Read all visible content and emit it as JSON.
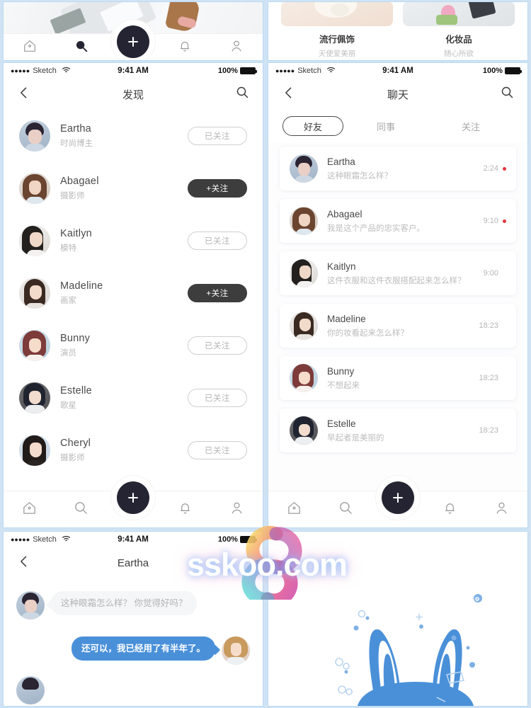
{
  "statusbar": {
    "carrier": "Sketch",
    "dots": "●●●●●",
    "time": "9:41 AM",
    "battery_pct": "100%",
    "wifi_icon": "wifi-icon",
    "battery_icon": "battery-full-icon"
  },
  "top_left": {
    "tabbar": {
      "items": [
        "home-icon",
        "search-icon",
        "bell-icon",
        "person-icon"
      ],
      "fab_icon": "plus-icon"
    }
  },
  "top_right": {
    "categories": [
      {
        "title": "流行佩饰",
        "subtitle": "天使爱美丽"
      },
      {
        "title": "化妆品",
        "subtitle": "随心所欲"
      }
    ]
  },
  "discover": {
    "title": "发现",
    "back_icon": "chevron-left-icon",
    "search_icon": "search-icon",
    "followed_label": "已关注",
    "follow_label": "+关注",
    "users": [
      {
        "name": "Eartha",
        "role": "时尚博主",
        "followed": true
      },
      {
        "name": "Abagael",
        "role": "摄影师",
        "followed": false
      },
      {
        "name": "Kaitlyn",
        "role": "模特",
        "followed": true
      },
      {
        "name": "Madeline",
        "role": "画家",
        "followed": false
      },
      {
        "name": "Bunny",
        "role": "演员",
        "followed": true
      },
      {
        "name": "Estelle",
        "role": "歌星",
        "followed": true
      },
      {
        "name": "Cheryl",
        "role": "摄影师",
        "followed": true
      }
    ],
    "tabbar": {
      "items": [
        "home-icon",
        "search-icon",
        "bell-icon",
        "person-icon"
      ],
      "fab_icon": "plus-icon"
    }
  },
  "chatlist": {
    "title": "聊天",
    "back_icon": "chevron-left-icon",
    "search_icon": "search-icon",
    "tabs": [
      {
        "label": "好友",
        "active": true
      },
      {
        "label": "同事",
        "active": false
      },
      {
        "label": "关注",
        "active": false
      }
    ],
    "rows": [
      {
        "name": "Eartha",
        "message": "这种眼霜怎么样？",
        "time": "2:24",
        "unread": true
      },
      {
        "name": "Abagael",
        "message": "我是这个产品的忠实客户。",
        "time": "9:10",
        "unread": true
      },
      {
        "name": "Kaitlyn",
        "message": "这件衣服和这件衣服搭配起来怎么样？",
        "time": "9:00",
        "unread": false
      },
      {
        "name": "Madeline",
        "message": "你的妆看起来怎么样？",
        "time": "18:23",
        "unread": false
      },
      {
        "name": "Bunny",
        "message": "不想起来",
        "time": "18:23",
        "unread": false
      },
      {
        "name": "Estelle",
        "message": "早起者是美丽的",
        "time": "18:23",
        "unread": false
      }
    ],
    "tabbar": {
      "items": [
        "home-icon",
        "search-icon",
        "bell-icon",
        "person-icon"
      ],
      "fab_icon": "plus-icon"
    }
  },
  "conversation": {
    "title": "Eartha",
    "back_icon": "chevron-left-icon",
    "messages": [
      {
        "side": "in",
        "text": "这种眼霜怎么样？ 你觉得好吗？"
      },
      {
        "side": "out",
        "text": "还可以，我已经用了有半年了。"
      }
    ]
  },
  "decor": {
    "watermark_text": "sskoo.com",
    "bunny_icon": "bunny-ears-icon"
  },
  "colors": {
    "frame": "#a8cde9",
    "accent_blue": "#4a90d9",
    "dark": "#242433",
    "unread_red": "#e8343c"
  }
}
